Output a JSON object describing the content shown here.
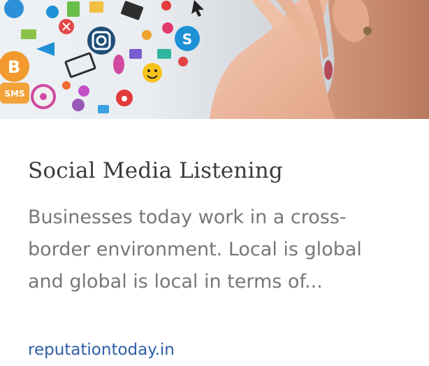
{
  "article": {
    "image_alt": "Hand cupped around an ear surrounded by social media icons",
    "icon_texts": {
      "sms": "SMS"
    },
    "title": "Social Media Listening",
    "description_lines": [
      "Businesses today work in a cross-",
      "border environment. Local is global",
      "and global is local in terms of..."
    ],
    "source": "reputationtoday.in"
  }
}
